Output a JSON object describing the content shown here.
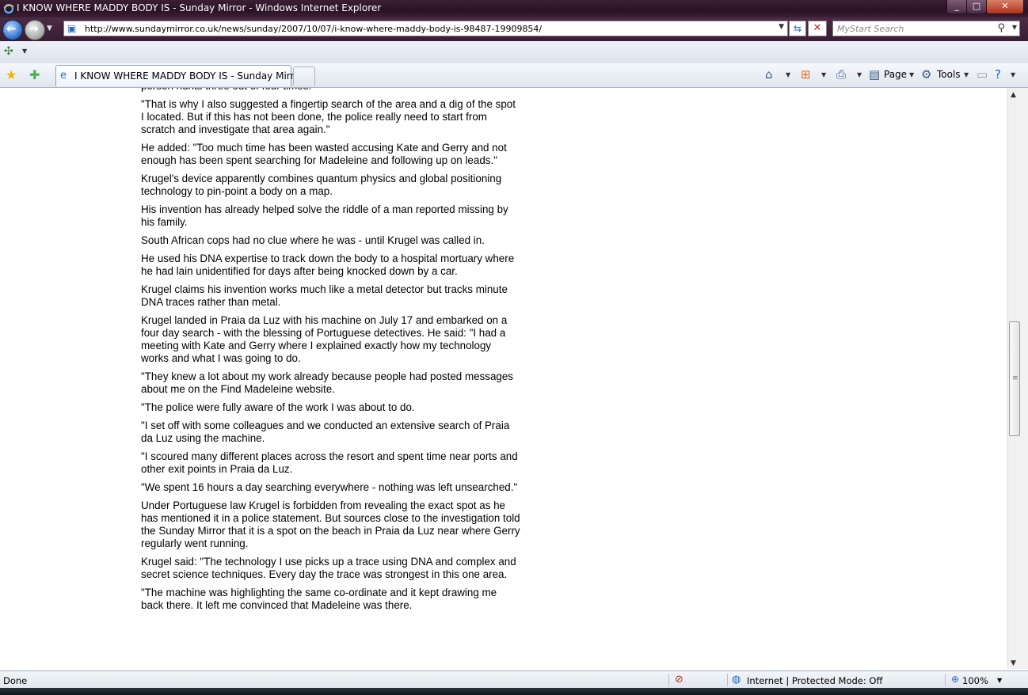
{
  "window": {
    "title": "I KNOW WHERE MADDY BODY IS - Sunday Mirror - Windows Internet Explorer",
    "minimize": "_",
    "maximize": "□",
    "close": "✕"
  },
  "nav": {
    "back_glyph": "←",
    "forward_glyph": "→",
    "url": "http://www.sundaymirror.co.uk/news/sunday/2007/10/07/i-know-where-maddy-body-is-98487-19909854/",
    "search_placeholder": "MyStart Search"
  },
  "tabs": [
    {
      "label": "I KNOW WHERE MADDY BODY IS - Sunday Mirror",
      "active": true
    }
  ],
  "command_bar": {
    "page_label": "Page",
    "tools_label": "Tools"
  },
  "article": {
    "paragraphs": [
      "person hunts three out of four times.",
      "\"That is why I also suggested a fingertip search of the area and a dig of the spot I located. But if this has not been done, the police really need to start from scratch and investigate that area again.\"",
      "He added: \"Too much time has been wasted accusing Kate and Gerry and not enough has been spent searching for Madeleine and following up on leads.\"",
      "Krugel's device apparently combines quantum physics and global positioning technology to pin-point a body on a map.",
      "His invention has already helped solve the riddle of a man reported missing by his family.",
      "South African cops had no clue where he was - until Krugel was called in.",
      "He used his DNA expertise to track down the body to a hospital mortuary where he had lain unidentified for days after being knocked down by a car.",
      "Krugel claims his invention works much like a metal detector but tracks minute DNA traces rather than metal.",
      "Krugel landed in Praia da Luz with his machine on July 17 and embarked on a four day search - with the blessing of Portuguese detectives. He said: \"I had a meeting with Kate and Gerry where I explained exactly how my technology works and what I was going to do.",
      "\"They knew a lot about my work already because people had posted messages about me on the Find Madeleine website.",
      "\"The police were fully aware of the work I was about to do.",
      "\"I set off with some colleagues and we conducted an extensive search of Praia da Luz using the machine.",
      "\"I scoured many different places across the resort and spent time near ports and other exit points in Praia da Luz.",
      "\"We spent 16 hours a day searching everywhere - nothing was left unsearched.\"",
      "Under Portuguese law Krugel is forbidden from revealing the exact spot as he has mentioned it in a police statement. But sources close to the investigation told the Sunday Mirror that it is a spot on the beach in Praia da Luz near where Gerry regularly went running.",
      "Krugel said: \"The technology I use picks up a trace using DNA and complex and secret science techniques. Every day the trace was strongest in this one area.",
      "\"The machine was highlighting the same co-ordinate and it kept drawing me back there. It left me convinced that Madeleine was there."
    ]
  },
  "status": {
    "text": "Done",
    "zone": "Internet | Protected Mode: Off",
    "zoom": "100%"
  }
}
